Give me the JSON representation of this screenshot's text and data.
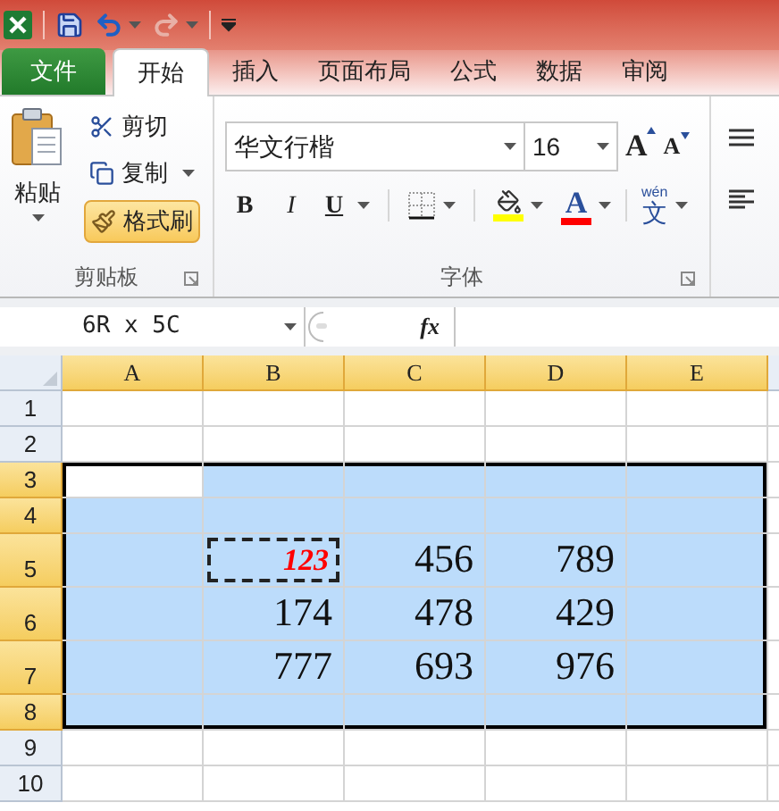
{
  "quick_access": {
    "undo": {
      "disabled": false
    },
    "redo": {
      "disabled": true
    }
  },
  "tabs": [
    {
      "label": "文件",
      "kind": "file",
      "selected": false
    },
    {
      "label": "开始",
      "kind": "tab",
      "selected": true
    },
    {
      "label": "插入",
      "kind": "tab",
      "selected": false
    },
    {
      "label": "页面布局",
      "kind": "tab",
      "selected": false
    },
    {
      "label": "公式",
      "kind": "tab",
      "selected": false
    },
    {
      "label": "数据",
      "kind": "tab",
      "selected": false
    },
    {
      "label": "审阅",
      "kind": "tab",
      "selected": false
    }
  ],
  "clipboard": {
    "paste": "粘贴",
    "cut": "剪切",
    "copy": "复制",
    "format_painter": {
      "label": "格式刷",
      "on": true
    },
    "group_label": "剪贴板"
  },
  "font": {
    "font_name": "华文行楷",
    "font_size": "16",
    "grow": "A",
    "shrink": "A",
    "bold": "B",
    "italic": "I",
    "underline": "U",
    "font_color": "A",
    "phonetic_top": "wén",
    "phonetic": "文",
    "group_label": "字体"
  },
  "formula_bar": {
    "name_box": "6R x 5C",
    "fx": "fx"
  },
  "sheet": {
    "columns": [
      {
        "label": "A",
        "selected": true
      },
      {
        "label": "B",
        "selected": true
      },
      {
        "label": "C",
        "selected": true
      },
      {
        "label": "D",
        "selected": true
      },
      {
        "label": "E",
        "selected": true
      }
    ],
    "rows": [
      {
        "label": "1",
        "selected": false,
        "cells": [
          {
            "selected": false,
            "active": false,
            "kind": "plain"
          },
          {
            "selected": false,
            "active": false,
            "kind": "plain"
          },
          {
            "selected": false,
            "active": false,
            "kind": "plain"
          },
          {
            "selected": false,
            "active": false,
            "kind": "plain"
          },
          {
            "selected": false,
            "active": false,
            "kind": "plain"
          }
        ]
      },
      {
        "label": "2",
        "selected": false,
        "cells": [
          {
            "selected": false,
            "active": false,
            "kind": "plain"
          },
          {
            "selected": false,
            "active": false,
            "kind": "plain"
          },
          {
            "selected": false,
            "active": false,
            "kind": "plain"
          },
          {
            "selected": false,
            "active": false,
            "kind": "plain"
          },
          {
            "selected": false,
            "active": false,
            "kind": "plain"
          }
        ]
      },
      {
        "label": "3",
        "selected": true,
        "cells": [
          {
            "selected": true,
            "active": true,
            "kind": "plain"
          },
          {
            "selected": true,
            "active": false,
            "kind": "plain"
          },
          {
            "selected": true,
            "active": false,
            "kind": "plain"
          },
          {
            "selected": true,
            "active": false,
            "kind": "plain"
          },
          {
            "selected": true,
            "active": false,
            "kind": "plain"
          }
        ]
      },
      {
        "label": "4",
        "selected": true,
        "cells": [
          {
            "selected": true,
            "active": false,
            "kind": "plain"
          },
          {
            "selected": true,
            "active": false,
            "kind": "plain"
          },
          {
            "selected": true,
            "active": false,
            "kind": "plain"
          },
          {
            "selected": true,
            "active": false,
            "kind": "plain"
          },
          {
            "selected": true,
            "active": false,
            "kind": "plain"
          }
        ]
      },
      {
        "label": "5",
        "selected": true,
        "cells": [
          {
            "selected": true,
            "active": false,
            "kind": "plain"
          },
          {
            "selected": true,
            "active": false,
            "kind": "copied",
            "value": "123",
            "color": "#ff0000"
          },
          {
            "selected": true,
            "active": false,
            "kind": "plain",
            "value": "456"
          },
          {
            "selected": true,
            "active": false,
            "kind": "plain",
            "value": "789"
          },
          {
            "selected": true,
            "active": false,
            "kind": "plain"
          }
        ]
      },
      {
        "label": "6",
        "selected": true,
        "cells": [
          {
            "selected": true,
            "active": false,
            "kind": "plain"
          },
          {
            "selected": true,
            "active": false,
            "kind": "plain",
            "value": "174"
          },
          {
            "selected": true,
            "active": false,
            "kind": "plain",
            "value": "478"
          },
          {
            "selected": true,
            "active": false,
            "kind": "plain",
            "value": "429"
          },
          {
            "selected": true,
            "active": false,
            "kind": "plain"
          }
        ]
      },
      {
        "label": "7",
        "selected": true,
        "cells": [
          {
            "selected": true,
            "active": false,
            "kind": "plain"
          },
          {
            "selected": true,
            "active": false,
            "kind": "plain",
            "value": "777"
          },
          {
            "selected": true,
            "active": false,
            "kind": "plain",
            "value": "693"
          },
          {
            "selected": true,
            "active": false,
            "kind": "plain",
            "value": "976"
          },
          {
            "selected": true,
            "active": false,
            "kind": "plain"
          }
        ]
      },
      {
        "label": "8",
        "selected": true,
        "cells": [
          {
            "selected": true,
            "active": false,
            "kind": "plain"
          },
          {
            "selected": true,
            "active": false,
            "kind": "plain"
          },
          {
            "selected": true,
            "active": false,
            "kind": "plain"
          },
          {
            "selected": true,
            "active": false,
            "kind": "plain"
          },
          {
            "selected": true,
            "active": false,
            "kind": "plain"
          }
        ]
      },
      {
        "label": "9",
        "selected": false,
        "cells": [
          {
            "selected": false,
            "active": false,
            "kind": "plain"
          },
          {
            "selected": false,
            "active": false,
            "kind": "plain"
          },
          {
            "selected": false,
            "active": false,
            "kind": "plain"
          },
          {
            "selected": false,
            "active": false,
            "kind": "plain"
          },
          {
            "selected": false,
            "active": false,
            "kind": "plain"
          }
        ]
      },
      {
        "label": "10",
        "selected": false,
        "cells": [
          {
            "selected": false,
            "active": false,
            "kind": "plain"
          },
          {
            "selected": false,
            "active": false,
            "kind": "plain"
          },
          {
            "selected": false,
            "active": false,
            "kind": "plain"
          },
          {
            "selected": false,
            "active": false,
            "kind": "plain"
          },
          {
            "selected": false,
            "active": false,
            "kind": "plain"
          }
        ]
      }
    ]
  }
}
